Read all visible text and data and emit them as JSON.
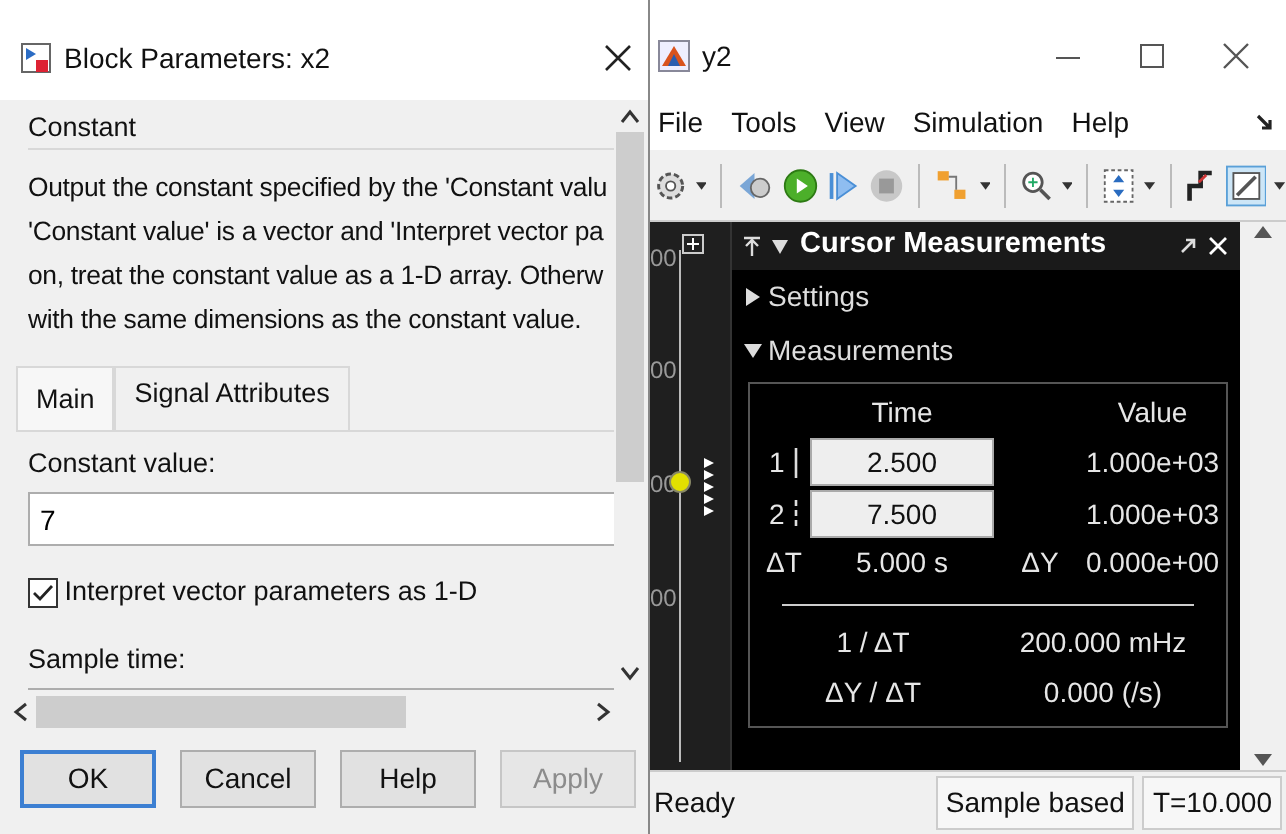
{
  "dialog": {
    "title": "Block Parameters: x2",
    "group_title": "Constant",
    "description_lines": [
      "Output the constant specified by the 'Constant valu",
      "'Constant value' is a vector and 'Interpret vector pa",
      "on, treat the constant value as a 1-D array. Otherw",
      "with the same dimensions as the constant value."
    ],
    "tabs": [
      {
        "label": "Main",
        "selected": true
      },
      {
        "label": "Signal Attributes",
        "selected": false
      }
    ],
    "constant_value": {
      "label": "Constant value:",
      "value": "7"
    },
    "checkbox": {
      "label": "Interpret vector parameters as 1-D",
      "checked": true
    },
    "sample_time": {
      "label": "Sample time:"
    },
    "buttons": [
      {
        "label": "OK",
        "focused": true,
        "disabled": false
      },
      {
        "label": "Cancel",
        "focused": false,
        "disabled": false
      },
      {
        "label": "Help",
        "focused": false,
        "disabled": false
      },
      {
        "label": "Apply",
        "focused": false,
        "disabled": true
      }
    ]
  },
  "scope": {
    "title": "y2",
    "menu": [
      "File",
      "Tools",
      "View",
      "Simulation",
      "Help"
    ],
    "axis_ticks": [
      "00",
      "00",
      "00",
      "00"
    ],
    "cursor_panel": {
      "title": "Cursor Measurements",
      "sections": [
        {
          "label": "Settings",
          "expanded": false
        },
        {
          "label": "Measurements",
          "expanded": true
        }
      ],
      "columns": [
        "Time",
        "Value"
      ],
      "cursors": [
        {
          "label": "1",
          "kind": "solid",
          "time": "2.500",
          "value": "1.000e+03"
        },
        {
          "label": "2",
          "kind": "dashed",
          "time": "7.500",
          "value": "1.000e+03"
        }
      ],
      "delta": {
        "dt_label": "ΔT",
        "dt": "5.000 s",
        "dy_label": "ΔY",
        "dy": "0.000e+00"
      },
      "derived": [
        {
          "label": "1 / ΔT",
          "value": "200.000 mHz"
        },
        {
          "label": "ΔY / ΔT",
          "value": "0.000 (/s)"
        }
      ]
    },
    "status_bar": {
      "status": "Ready",
      "mode": "Sample based",
      "time": "T=10.000"
    }
  }
}
